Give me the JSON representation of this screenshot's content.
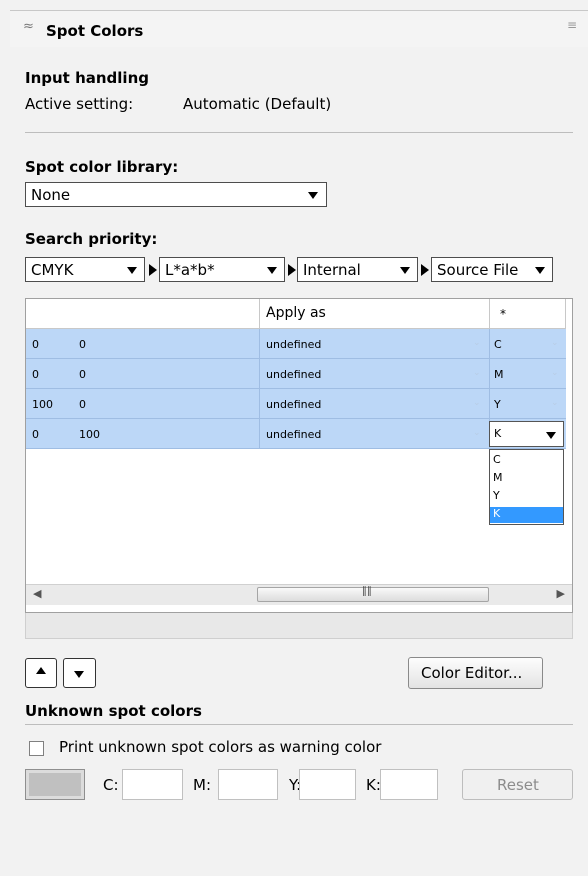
{
  "panel": {
    "title": "Spot Colors"
  },
  "input_handling": {
    "heading": "Input handling",
    "active_label": "Active setting:",
    "active_value": "Automatic (Default)"
  },
  "library": {
    "label": "Spot color library:",
    "value": "None"
  },
  "priority": {
    "label": "Search priority:",
    "options": [
      "CMYK",
      "L*a*b*",
      "Internal",
      "Source File"
    ]
  },
  "table": {
    "headers": [
      "",
      "Apply as",
      "*"
    ],
    "rows": [
      {
        "a": "0",
        "b": "0",
        "apply": "undefined",
        "ch": "C"
      },
      {
        "a": "0",
        "b": "0",
        "apply": "undefined",
        "ch": "M"
      },
      {
        "a": "100",
        "b": "0",
        "apply": "undefined",
        "ch": "Y"
      },
      {
        "a": "0",
        "b": "100",
        "apply": "undefined",
        "ch": "K"
      }
    ],
    "dropdown_options": [
      "C",
      "M",
      "Y",
      "K"
    ],
    "dropdown_selected": "K"
  },
  "buttons": {
    "color_editor": "Color Editor...",
    "reset": "Reset"
  },
  "unknown": {
    "heading": "Unknown spot colors",
    "checkbox_label": "Print unknown spot colors as warning color",
    "c_label": "C:",
    "m_label": "M:",
    "y_label": "Y:",
    "k_label": "K:"
  },
  "colors": {
    "row_highlight": "#bcd7f7",
    "selected_option": "#3399ff",
    "swatch": "#c0c0c0"
  }
}
